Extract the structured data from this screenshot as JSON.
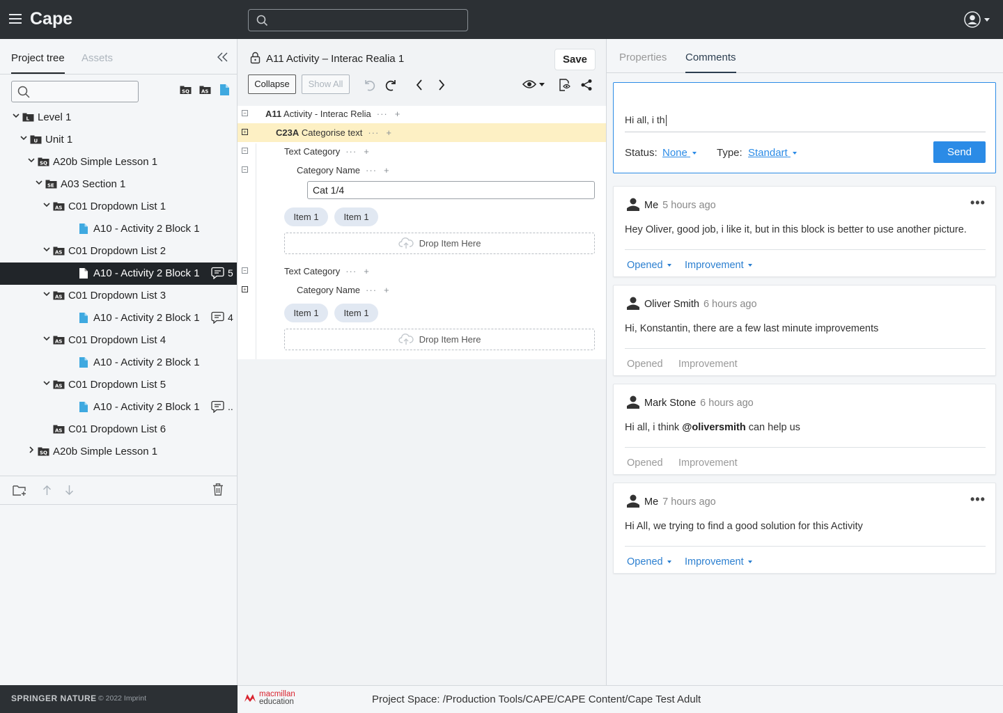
{
  "app": {
    "title": "Cape",
    "search_placeholder": ""
  },
  "left": {
    "tabs": [
      {
        "label": "Project tree",
        "active": true
      },
      {
        "label": "Assets",
        "active": false
      }
    ],
    "search_placeholder": "",
    "tool_icons": [
      "sq-filter-icon",
      "as-filter-icon",
      "file-filter-icon"
    ],
    "tree": [
      {
        "label": "Level 1",
        "icon": "level-folder-icon",
        "expanded": true
      },
      {
        "label": "Unit 1",
        "icon": "unit-folder-icon",
        "expanded": true
      },
      {
        "label": "A20b Simple Lesson 1",
        "icon": "sq-folder-icon",
        "expanded": true
      },
      {
        "label": "A03 Section 1",
        "icon": "se-folder-icon",
        "expanded": true
      },
      {
        "label": "C01 Dropdown List 1",
        "icon": "as-folder-icon",
        "expanded": true
      },
      {
        "label": "A10 - Activity 2 Block 1",
        "icon": "file-icon"
      },
      {
        "label": "C01 Dropdown List 2",
        "icon": "as-folder-icon",
        "expanded": true
      },
      {
        "label": "A10 - Activity 2 Block 1",
        "icon": "file-icon",
        "selected": true,
        "comments": "5"
      },
      {
        "label": "C01 Dropdown List 3",
        "icon": "as-folder-icon",
        "expanded": true
      },
      {
        "label": "A10 - Activity 2 Block 1",
        "icon": "file-icon",
        "comments": "4"
      },
      {
        "label": "C01 Dropdown List 4",
        "icon": "as-folder-icon",
        "expanded": true
      },
      {
        "label": "A10 - Activity 2 Block 1",
        "icon": "file-icon"
      },
      {
        "label": "C01 Dropdown List 5",
        "icon": "as-folder-icon",
        "expanded": true
      },
      {
        "label": "A10 - Activity 2 Block 1",
        "icon": "file-icon",
        "comments": ".."
      },
      {
        "label": "C01 Dropdown List 6",
        "icon": "as-folder-icon"
      },
      {
        "label": "A20b Simple Lesson 1",
        "icon": "sq-folder-icon",
        "expanded": false
      }
    ],
    "footer": {
      "brand": "SPRINGER NATURE",
      "copyright": "© 2022 Imprint"
    }
  },
  "center": {
    "title": "A11 Activity – Interac Realia 1",
    "save_label": "Save",
    "collapse_label": "Collapse",
    "show_all_label": "Show All",
    "editor": {
      "root": {
        "code": "A11",
        "label": "Activity - Interac Relia"
      },
      "block": {
        "code": "C23A",
        "label": "Categorise text"
      },
      "text_category_label": "Text Category",
      "category_name_label": "Category Name",
      "category_value": "Cat 1/4",
      "item_label": "Item 1",
      "drop_label": "Drop Item Here",
      "dots": "···",
      "plus": "+"
    }
  },
  "footer": {
    "publisher_line1": "macmillan",
    "publisher_line2": "education",
    "path": "Project Space: /Production Tools/CAPE/CAPE Content/Cape Test Adult"
  },
  "right": {
    "tabs": [
      {
        "label": "Properties",
        "active": false
      },
      {
        "label": "Comments",
        "active": true
      }
    ],
    "compose": {
      "text": "Hi all, i th",
      "status_label": "Status:",
      "status_value": "None",
      "type_label": "Type:",
      "type_value": "Standart",
      "send_label": "Send"
    },
    "comments": [
      {
        "author": "Me",
        "time": "5 hours ago",
        "body": "Hey Oliver, good job, i like it, but in this block is better to use another picture.",
        "status": "Opened",
        "type": "Improvement",
        "editable": true
      },
      {
        "author": "Oliver Smith",
        "time": "6 hours ago",
        "body": "Hi, Konstantin, there are a few last minute improvements",
        "status": "Opened",
        "type": "Improvement",
        "editable": false
      },
      {
        "author": "Mark Stone",
        "time": "6 hours ago",
        "body_pre": "Hi all, i think ",
        "mention": "@oliversmith",
        "body_post": " can help us",
        "status": "Opened",
        "type": "Improvement",
        "editable": false
      },
      {
        "author": "Me",
        "time": "7 hours ago",
        "body": "Hi All, we trying to find a good solution for this Activity",
        "status": "Opened",
        "type": "Improvement",
        "editable": true
      }
    ]
  },
  "colors": {
    "accent": "#2b8be6",
    "topbar": "#2c3034",
    "highlight": "#fdf0c4",
    "chip": "#e1e8f2"
  }
}
